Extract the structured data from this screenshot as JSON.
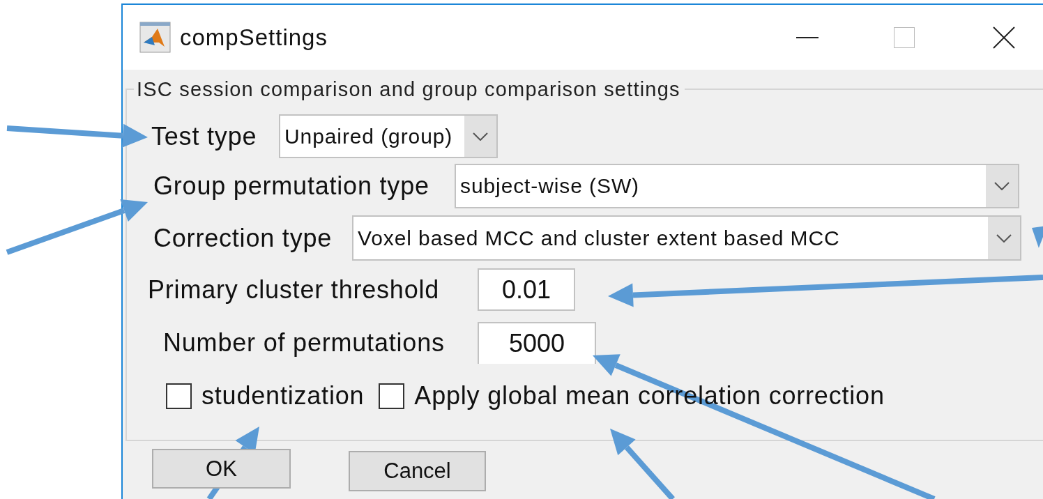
{
  "window": {
    "title": "compSettings"
  },
  "group_box": {
    "title": "ISC session comparison and group comparison settings"
  },
  "fields": [
    {
      "kind": "dropdown",
      "label": "Test type",
      "value": "Unpaired (group)"
    },
    {
      "kind": "dropdown",
      "label": "Group permutation type",
      "value": "subject-wise (SW)"
    },
    {
      "kind": "dropdown",
      "label": "Correction type",
      "value": "Voxel based MCC and cluster extent based MCC"
    },
    {
      "kind": "text",
      "label": "Primary cluster threshold",
      "value": "0.01"
    },
    {
      "kind": "text",
      "label": "Number of permutations",
      "value": "5000"
    }
  ],
  "checkboxes": [
    {
      "label": "studentization",
      "checked": false
    },
    {
      "label": "Apply global mean correlation correction",
      "checked": false
    }
  ],
  "buttons": [
    "OK",
    "Cancel"
  ]
}
